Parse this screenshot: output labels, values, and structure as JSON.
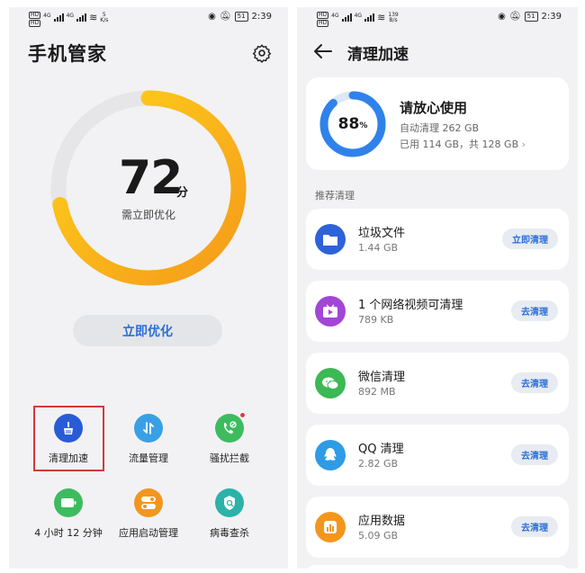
{
  "status_bar": {
    "left_screen": {
      "sim1": "HD",
      "sim2": "HD",
      "net1": "4G",
      "net2": "4G",
      "speed_value": "5",
      "speed_unit": "K/s"
    },
    "right_screen": {
      "sim1": "HD",
      "sim2": "HD",
      "net1": "4G",
      "net2": "4G",
      "speed_value": "139",
      "speed_unit": "B/s"
    },
    "battery": "51",
    "time": "2:39"
  },
  "phone_manager": {
    "title": "手机管家",
    "score": {
      "value": "72",
      "unit": "分",
      "subtitle": "需立即优化",
      "max": 100
    },
    "optimize_button": "立即优化",
    "tools": [
      {
        "label": "清理加速",
        "icon": "broom-icon",
        "color": "#2a5bd7",
        "highlighted": true
      },
      {
        "label": "流量管理",
        "icon": "data-flow-icon",
        "color": "#3aa0e6",
        "highlighted": false
      },
      {
        "label": "骚扰拦截",
        "icon": "call-block-icon",
        "color": "#3dbb5f",
        "highlighted": false,
        "badge": true
      },
      {
        "label": "4 小时 12 分钟",
        "icon": "battery-icon",
        "color": "#3dbb5f",
        "highlighted": false
      },
      {
        "label": "应用启动管理",
        "icon": "toggle-icon",
        "color": "#f2961e",
        "highlighted": false
      },
      {
        "label": "病毒查杀",
        "icon": "shield-icon",
        "color": "#2cb2a8",
        "highlighted": false
      }
    ]
  },
  "cleanup": {
    "title": "清理加速",
    "summary": {
      "percent": "88",
      "percent_unit": "%",
      "headline": "请放心使用",
      "auto_clean": "自动清理 262 GB",
      "storage": "已用 114 GB，共 128 GB",
      "used_fraction": 0.88
    },
    "section_label": "推荐清理",
    "items": [
      {
        "title": "垃圾文件",
        "size": "1.44 GB",
        "button": "立即清理",
        "icon": "folder-icon",
        "color": "#2e62d8"
      },
      {
        "title": "1 个网络视频可清理",
        "size": "789 KB",
        "button": "去清理",
        "icon": "video-icon",
        "color": "#a246d6"
      },
      {
        "title": "微信清理",
        "size": "892 MB",
        "button": "去清理",
        "icon": "wechat-icon",
        "color": "#3cb855"
      },
      {
        "title": "QQ 清理",
        "size": "2.82 GB",
        "button": "去清理",
        "icon": "qq-icon",
        "color": "#2e9be6"
      },
      {
        "title": "应用数据",
        "size": "5.09 GB",
        "button": "去清理",
        "icon": "app-data-icon",
        "color": "#f3961d"
      }
    ]
  },
  "colors": {
    "accent": "#2a6fd6",
    "gauge_start": "#f7a21b",
    "gauge_end": "#ffd21a",
    "highlight_border": "#d23b3b"
  }
}
